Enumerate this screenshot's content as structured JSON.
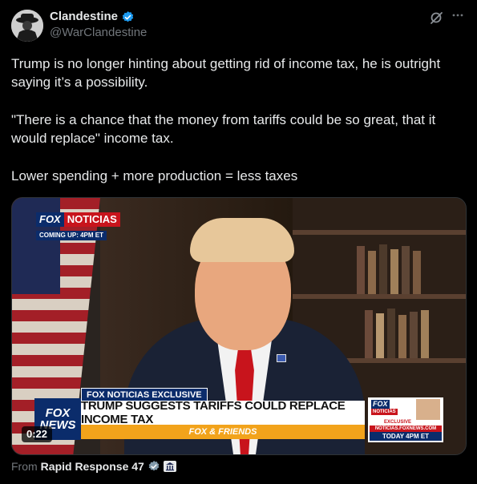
{
  "author": {
    "display_name": "Clandestine",
    "handle": "@WarClandestine",
    "verified": true,
    "verified_color": "#1d9bf0"
  },
  "post": {
    "paragraphs": [
      "Trump is no longer hinting about getting rid of income tax, he is outright saying it’s a possibility.",
      "\"There is a chance that the money from tariffs could be so great, that it would replace\" income tax.",
      "Lower spending + more production = less taxes"
    ]
  },
  "media": {
    "type": "video",
    "duration": "0:22",
    "overlay": {
      "bug_fox": "FOX",
      "bug_noticias": "NOTICIAS",
      "bug_coming_up": "COMING UP: 4PM ET",
      "exclusive_label": "FOX NOTICIAS EXCLUSIVE",
      "headline": "TRUMP SUGGESTS TARIFFS COULD REPLACE INCOME TAX",
      "show_name": "FOX & FRIENDS",
      "logo_line1": "FOX",
      "logo_line2": "NEWS",
      "promo_fox": "FOX",
      "promo_noticias": "NOTICIAS",
      "promo_exclusive": "EXCLUSIVE",
      "promo_url": "NOTICIAS.FOXNEWS.COM",
      "promo_time": "TODAY 4PM ET"
    }
  },
  "attribution": {
    "from_label": "From",
    "source_name": "Rapid Response 47",
    "badge_color": "#829aab"
  },
  "icons": {
    "grok": "grok-icon",
    "more": "more-icon",
    "verified": "verified-badge-icon",
    "government": "government-building-icon"
  }
}
